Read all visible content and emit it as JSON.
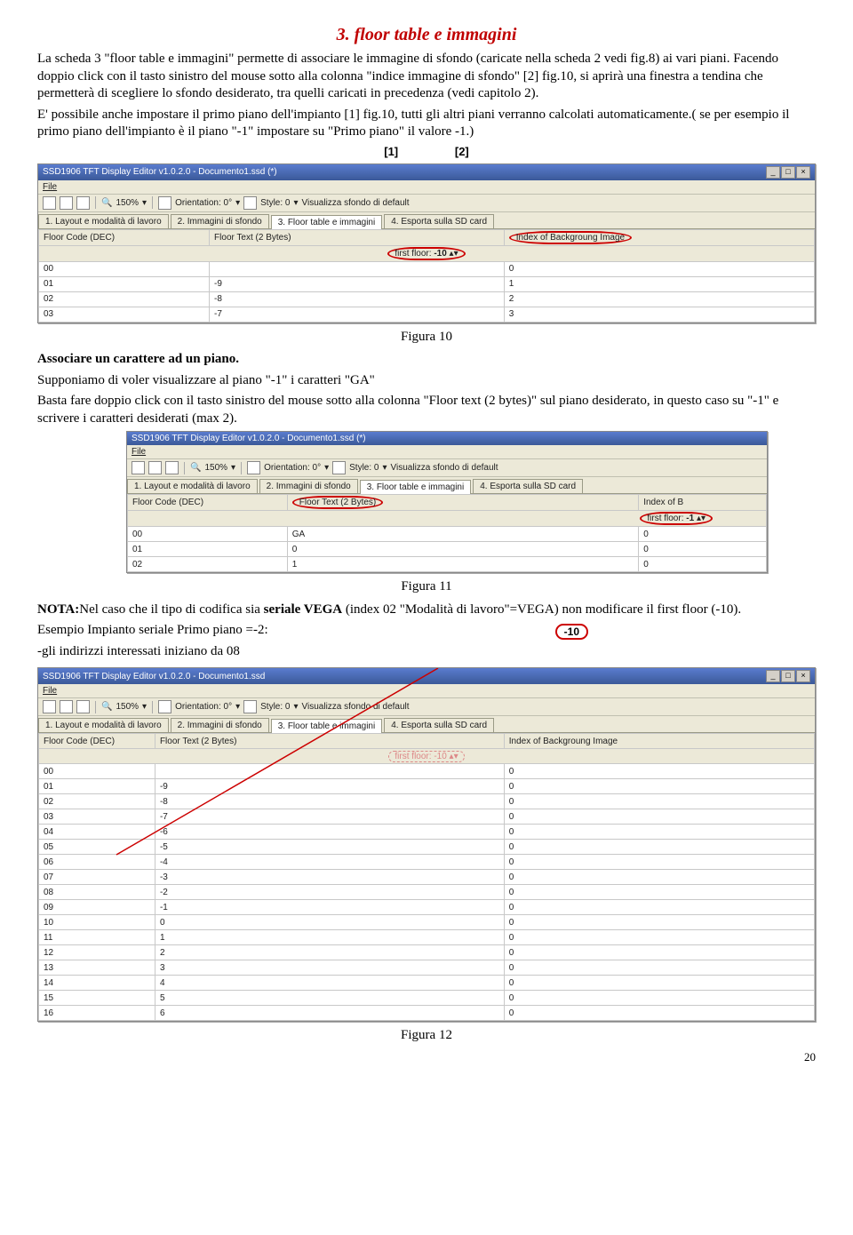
{
  "heading": "3. floor table e immagini",
  "para1": "La scheda 3 \"floor table e immagini\" permette di associare le immagine di sfondo (caricate nella scheda 2 vedi fig.8) ai vari piani. Facendo doppio click con il tasto sinistro del mouse sotto alla colonna \"indice immagine di sfondo\" [2] fig.10, si aprirà una finestra a tendina che permetterà di scegliere lo sfondo desiderato, tra quelli caricati in precedenza (vedi capitolo 2).",
  "para2": "E' possibile anche impostare il primo piano dell'impianto [1] fig.10, tutti gli altri piani verranno calcolati automaticamente.( se per esempio il primo piano dell'impianto è il piano \"-1\" impostare su \"Primo piano\" il valore -1.)",
  "label1": "[1]",
  "label2": "[2]",
  "app_title": "SSD1906 TFT Display Editor v1.0.2.0 - Documento1.ssd (*)",
  "app_title2": "SSD1906 TFT Display Editor v1.0.2.0 - Documento1.ssd",
  "file_menu": "File",
  "zoom": "150%",
  "orientation": "Orientation: 0°",
  "style": "Style: 0",
  "vis_sfondo": "Visualizza sfondo di default",
  "tabs": [
    "1. Layout e modalità di lavoro",
    "2. Immagini di sfondo",
    "3. Floor table e immagini",
    "4. Esporta sulla SD card"
  ],
  "col1": "Floor Code (DEC)",
  "col2": "Floor Text (2 Bytes)",
  "col3": "Index of Backgroung Image",
  "col3b": "Index of B",
  "first_floor": "first floor:",
  "ff_val": "-10",
  "ff_val2": "-1",
  "fig10_rows": [
    [
      "00",
      "",
      "0"
    ],
    [
      "01",
      "-9",
      "1"
    ],
    [
      "02",
      "-8",
      "2"
    ],
    [
      "03",
      "-7",
      "3"
    ]
  ],
  "cap10": "Figura 10",
  "assoc_title": "Associare un carattere ad un piano.",
  "assoc_p1": "Supponiamo di voler visualizzare al piano \"-1\" i caratteri \"GA\"",
  "assoc_p2": "Basta fare doppio click con il tasto sinistro del mouse sotto alla colonna \"Floor text (2 bytes)\" sul piano desiderato, in questo caso su \"-1\" e scrivere i caratteri desiderati (max 2).",
  "fig11_rows": [
    [
      "00",
      "GA",
      "0"
    ],
    [
      "01",
      "0",
      "0"
    ],
    [
      "02",
      "1",
      "0"
    ]
  ],
  "cap11": "Figura 11",
  "nota_label": "NOTA:",
  "nota_text": "Nel caso che il tipo di codifica sia ",
  "nota_bold": "seriale VEGA",
  "nota_text2": " (index 02 \"Modalità di lavoro\"=VEGA) non modificare il first floor (-10).",
  "esempio": "Esempio Impianto seriale Primo piano =-2:",
  "esempio2": "-gli indirizzi interessati iniziano da 08",
  "neg10": "-10",
  "fig12_rows": [
    [
      "00",
      "",
      "0"
    ],
    [
      "01",
      "-9",
      "0"
    ],
    [
      "02",
      "-8",
      "0"
    ],
    [
      "03",
      "-7",
      "0"
    ],
    [
      "04",
      "-6",
      "0"
    ],
    [
      "05",
      "-5",
      "0"
    ],
    [
      "06",
      "-4",
      "0"
    ],
    [
      "07",
      "-3",
      "0"
    ],
    [
      "08",
      "-2",
      "0"
    ],
    [
      "09",
      "-1",
      "0"
    ],
    [
      "10",
      "0",
      "0"
    ],
    [
      "11",
      "1",
      "0"
    ],
    [
      "12",
      "2",
      "0"
    ],
    [
      "13",
      "3",
      "0"
    ],
    [
      "14",
      "4",
      "0"
    ],
    [
      "15",
      "5",
      "0"
    ],
    [
      "16",
      "6",
      "0"
    ]
  ],
  "cap12": "Figura 12",
  "page": "20"
}
